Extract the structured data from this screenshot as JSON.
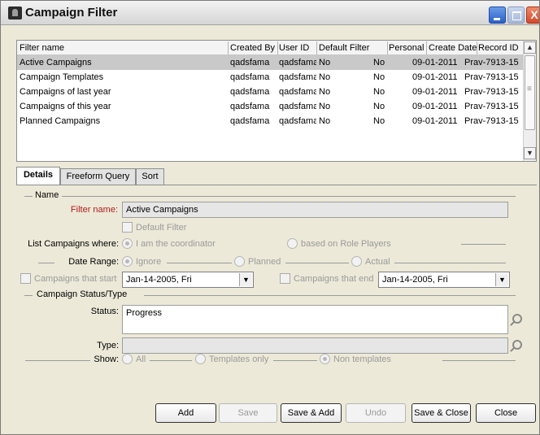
{
  "window": {
    "title": "Campaign Filter",
    "close_glyph": "X"
  },
  "list": {
    "columns": [
      "Filter name",
      "Created By",
      "User ID",
      "Default Filter",
      "Personal",
      "Create Date",
      "Record ID"
    ],
    "rows": [
      [
        "Active Campaigns",
        "qadsfama",
        "qadsfama",
        "No",
        "No",
        "09-01-2011",
        "Prav-7913-15"
      ],
      [
        "Campaign Templates",
        "qadsfama",
        "qadsfama",
        "No",
        "No",
        "09-01-2011",
        "Prav-7913-15"
      ],
      [
        "Campaigns of last year",
        "qadsfama",
        "qadsfama",
        "No",
        "No",
        "09-01-2011",
        "Prav-7913-15"
      ],
      [
        "Campaigns of this year",
        "qadsfama",
        "qadsfama",
        "No",
        "No",
        "09-01-2011",
        "Prav-7913-15"
      ],
      [
        "Planned Campaigns",
        "qadsfama",
        "qadsfama",
        "No",
        "No",
        "09-01-2011",
        "Prav-7913-15"
      ]
    ],
    "selected_row": "Active Campaigns"
  },
  "tabs": [
    "Details",
    "Freeform Query",
    "Sort"
  ],
  "form": {
    "name_section": "Name",
    "filter_name_label": "Filter name:",
    "filter_name_value": "Active Campaigns",
    "default_filter_label": "Default Filter",
    "list_campaigns_label": "List Campaigns where:",
    "option_coordinator": "I am the coordinator",
    "option_role_players": "based on Role Players",
    "date_range_label": "Date Range:",
    "date_ignore": "Ignore",
    "date_planned": "Planned",
    "date_actual": "Actual",
    "start_label": "Campaigns that start",
    "start_value": "Jan-14-2005,  Fri",
    "end_label": "Campaigns that end",
    "end_value": "Jan-14-2005,  Fri",
    "status_section": "Campaign Status/Type",
    "status_label": "Status:",
    "status_value": "Progress",
    "type_label": "Type:",
    "type_value": "",
    "show_label": "Show:",
    "show_all": "All",
    "show_templates": "Templates only",
    "show_non_templates": "Non templates"
  },
  "buttons": {
    "add": "Add",
    "save": "Save",
    "save_add": "Save & Add",
    "undo": "Undo",
    "save_close": "Save & Close",
    "close": "Close"
  }
}
